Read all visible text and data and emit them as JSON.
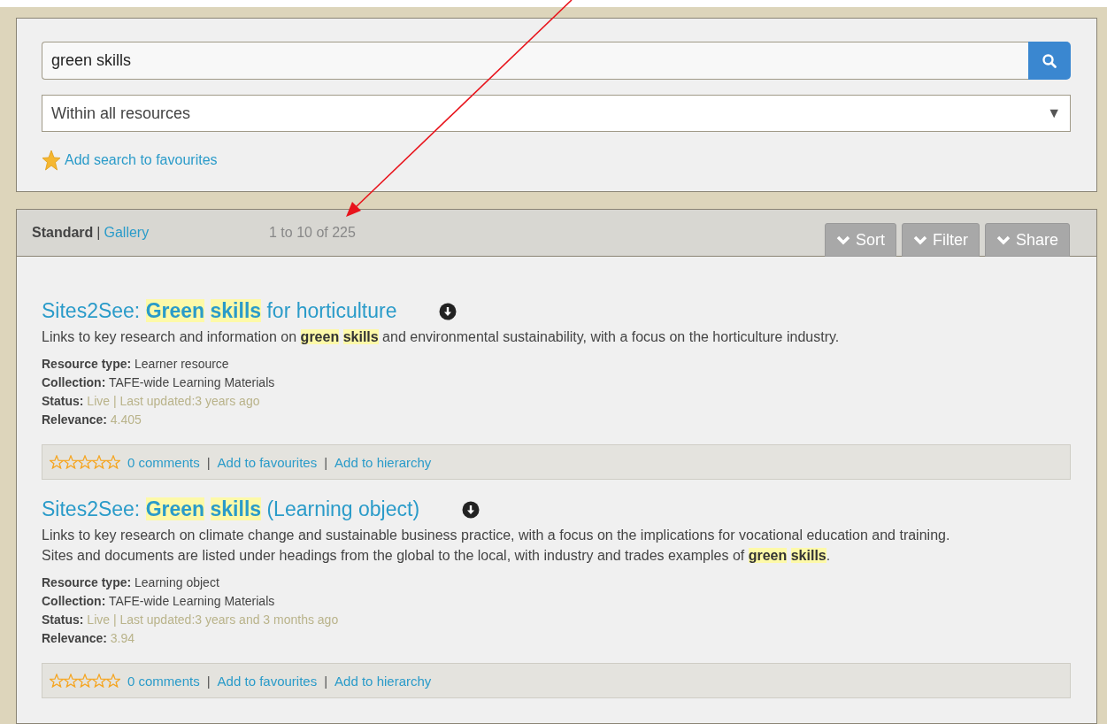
{
  "search": {
    "value": "green skills"
  },
  "scope": {
    "value": "Within all resources",
    "arrow": "▼"
  },
  "favourite_search": {
    "label": "Add search to favourites"
  },
  "results_bar": {
    "views": [
      {
        "label": "Standard",
        "selected": true
      },
      {
        "label": "Gallery",
        "selected": false
      }
    ],
    "separator": "|",
    "count": "1 to 10 of 225",
    "buttons": [
      "Sort",
      "Filter",
      "Share"
    ]
  },
  "annotation": {
    "arrow": true
  },
  "results": [
    {
      "title": [
        {
          "text": "Sites2See: ",
          "highlight": false
        },
        {
          "text": "Green skills",
          "highlight": true
        },
        {
          "text": " for horticulture",
          "highlight": false
        }
      ],
      "description": [
        {
          "text": "Links to key research and information on ",
          "highlight": false
        },
        {
          "text": "green skills",
          "highlight": true
        },
        {
          "text": " and environmental sustainability, with a focus on the horticulture industry.",
          "highlight": false
        }
      ],
      "fields": [
        {
          "label": "Resource type:",
          "value": "Learner resource",
          "kind": "plain"
        },
        {
          "label": "Collection:",
          "value": "TAFE-wide Learning Materials",
          "kind": "plain"
        },
        {
          "label": "Status:",
          "value": "Live | Last updated:3 years ago",
          "kind": "muted"
        },
        {
          "label": "Relevance:",
          "value": "4.405",
          "kind": "muted"
        }
      ],
      "stars": 0,
      "links": [
        "0 comments",
        "Add to favourites",
        "Add to hierarchy"
      ]
    },
    {
      "title": [
        {
          "text": "Sites2See: ",
          "highlight": false
        },
        {
          "text": "Green skills",
          "highlight": true
        },
        {
          "text": " (Learning object)",
          "highlight": false
        }
      ],
      "description": [
        {
          "text": "Links to key research on climate change and sustainable business practice, with a focus on the implications for vocational education and training. Sites and documents are listed under headings from the global to the local, with industry and trades examples of ",
          "highlight": false
        },
        {
          "text": "green skills",
          "highlight": true
        },
        {
          "text": ".",
          "highlight": false
        }
      ],
      "fields": [
        {
          "label": "Resource type:",
          "value": "Learning object",
          "kind": "plain"
        },
        {
          "label": "Collection:",
          "value": "TAFE-wide Learning Materials",
          "kind": "plain"
        },
        {
          "label": "Status:",
          "value": "Live | Last updated:3 years and 3 months ago",
          "kind": "muted"
        },
        {
          "label": "Relevance:",
          "value": "3.94",
          "kind": "muted"
        }
      ],
      "stars": 0,
      "links": [
        "0 comments",
        "Add to favourites",
        "Add to hierarchy"
      ]
    }
  ]
}
